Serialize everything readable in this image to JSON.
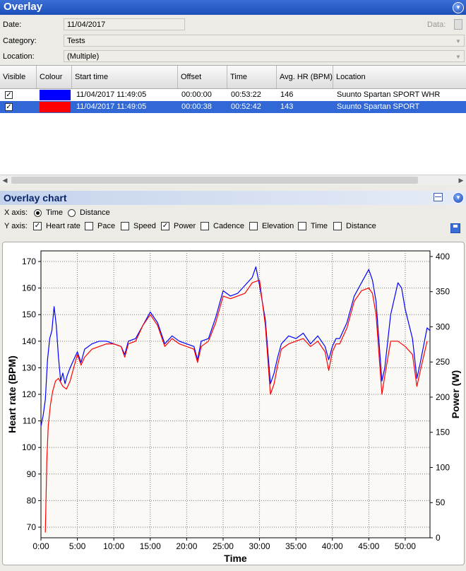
{
  "header": {
    "title": "Overlay"
  },
  "fields": {
    "date_label": "Date:",
    "date_value": "11/04/2017",
    "data_label": "Data:",
    "category_label": "Category:",
    "category_value": "Tests",
    "location_label": "Location:",
    "location_value": "(Multiple)"
  },
  "grid": {
    "columns": [
      "Visible",
      "Colour",
      "Start time",
      "Offset",
      "Time",
      "Avg. HR (BPM)",
      "Location"
    ],
    "rows": [
      {
        "visible": true,
        "colour": "#0000ff",
        "start": "11/04/2017 11:49:05",
        "offset": "00:00:00",
        "time": "00:53:22",
        "avghr": "146",
        "location": "Suunto Spartan SPORT WHR"
      },
      {
        "visible": true,
        "colour": "#ff0000",
        "start": "11/04/2017 11:49:05",
        "offset": "00:00:38",
        "time": "00:52:42",
        "avghr": "143",
        "location": "Suunto Spartan SPORT"
      }
    ]
  },
  "overlay_chart": {
    "title": "Overlay chart",
    "xaxis_label": "X axis:",
    "x_options": [
      {
        "label": "Time",
        "selected": true
      },
      {
        "label": "Distance",
        "selected": false
      }
    ],
    "yaxis_label": "Y axis:",
    "y_options": [
      {
        "label": "Heart rate",
        "checked": true
      },
      {
        "label": "Pace",
        "checked": false
      },
      {
        "label": "Speed",
        "checked": false
      },
      {
        "label": "Power",
        "checked": true
      },
      {
        "label": "Cadence",
        "checked": false
      },
      {
        "label": "Elevation",
        "checked": false
      },
      {
        "label": "Time",
        "checked": false
      },
      {
        "label": "Distance",
        "checked": false
      }
    ]
  },
  "chart_data": {
    "type": "line",
    "xlabel": "Time",
    "ylabel": "Heart rate (BPM)",
    "y2label": "Power (W)",
    "x_ticks": [
      "0:00",
      "5:00",
      "10:00",
      "15:00",
      "20:00",
      "25:00",
      "30:00",
      "35:00",
      "40:00",
      "45:00",
      "50:00"
    ],
    "xlim": [
      0,
      53.4
    ],
    "ylim": [
      66,
      174
    ],
    "y2lim": [
      0,
      408
    ],
    "y_ticks": [
      70,
      80,
      90,
      100,
      110,
      120,
      130,
      140,
      150,
      160,
      170
    ],
    "y2_ticks": [
      0,
      50,
      100,
      150,
      200,
      250,
      300,
      350,
      400
    ],
    "grid": true,
    "series": [
      {
        "color": "#0000ff",
        "points": [
          [
            0,
            108
          ],
          [
            0.3,
            112
          ],
          [
            0.6,
            118
          ],
          [
            0.9,
            133
          ],
          [
            1.2,
            141
          ],
          [
            1.5,
            144
          ],
          [
            1.8,
            153
          ],
          [
            2.1,
            146
          ],
          [
            2.4,
            134
          ],
          [
            2.7,
            125
          ],
          [
            3,
            128
          ],
          [
            3.3,
            124
          ],
          [
            3.6,
            127
          ],
          [
            4,
            130
          ],
          [
            4.5,
            133
          ],
          [
            5,
            136
          ],
          [
            5.5,
            132
          ],
          [
            6,
            137
          ],
          [
            7,
            139
          ],
          [
            8,
            140
          ],
          [
            9,
            140
          ],
          [
            10,
            139
          ],
          [
            11,
            138
          ],
          [
            11.5,
            135
          ],
          [
            12,
            140
          ],
          [
            13,
            141
          ],
          [
            14,
            146
          ],
          [
            15,
            151
          ],
          [
            16,
            147
          ],
          [
            17,
            139
          ],
          [
            18,
            142
          ],
          [
            19,
            140
          ],
          [
            20,
            139
          ],
          [
            21,
            138
          ],
          [
            21.5,
            133
          ],
          [
            22,
            140
          ],
          [
            23,
            141
          ],
          [
            24,
            149
          ],
          [
            25,
            159
          ],
          [
            26,
            157
          ],
          [
            27,
            158
          ],
          [
            28,
            161
          ],
          [
            29,
            164
          ],
          [
            29.5,
            168
          ],
          [
            30,
            161
          ],
          [
            30.8,
            148
          ],
          [
            31.5,
            124
          ],
          [
            32,
            128
          ],
          [
            32.5,
            134
          ],
          [
            33,
            139
          ],
          [
            34,
            142
          ],
          [
            35,
            141
          ],
          [
            36,
            143
          ],
          [
            37,
            139
          ],
          [
            38,
            142
          ],
          [
            39,
            138
          ],
          [
            39.5,
            133
          ],
          [
            40,
            138
          ],
          [
            40.5,
            141
          ],
          [
            41,
            141
          ],
          [
            42,
            147
          ],
          [
            43,
            157
          ],
          [
            44,
            162
          ],
          [
            45,
            167
          ],
          [
            45.5,
            163
          ],
          [
            46,
            155
          ],
          [
            46.8,
            125
          ],
          [
            47.2,
            130
          ],
          [
            48,
            150
          ],
          [
            49,
            162
          ],
          [
            49.5,
            160
          ],
          [
            50,
            152
          ],
          [
            51,
            141
          ],
          [
            51.6,
            126
          ],
          [
            52,
            131
          ],
          [
            53,
            145
          ],
          [
            53.4,
            144
          ]
        ]
      },
      {
        "color": "#ff0000",
        "points": [
          [
            0.6,
            68
          ],
          [
            0.8,
            95
          ],
          [
            1,
            108
          ],
          [
            1.3,
            116
          ],
          [
            1.6,
            121
          ],
          [
            2,
            125
          ],
          [
            2.4,
            126
          ],
          [
            3,
            123
          ],
          [
            3.5,
            122
          ],
          [
            4,
            125
          ],
          [
            4.5,
            130
          ],
          [
            5,
            135
          ],
          [
            5.5,
            131
          ],
          [
            6,
            134
          ],
          [
            7,
            137
          ],
          [
            8,
            138
          ],
          [
            9,
            139
          ],
          [
            10,
            139
          ],
          [
            11,
            138
          ],
          [
            11.5,
            134
          ],
          [
            12,
            139
          ],
          [
            13,
            140
          ],
          [
            14,
            146
          ],
          [
            15,
            150
          ],
          [
            16,
            146
          ],
          [
            17,
            138
          ],
          [
            18,
            141
          ],
          [
            19,
            139
          ],
          [
            20,
            138
          ],
          [
            21,
            137
          ],
          [
            21.5,
            132
          ],
          [
            22,
            138
          ],
          [
            23,
            140
          ],
          [
            24,
            147
          ],
          [
            25,
            157
          ],
          [
            26,
            156
          ],
          [
            27,
            157
          ],
          [
            28,
            158
          ],
          [
            29,
            162
          ],
          [
            30,
            163
          ],
          [
            30.8,
            146
          ],
          [
            31.5,
            120
          ],
          [
            32,
            124
          ],
          [
            32.5,
            131
          ],
          [
            33,
            137
          ],
          [
            34,
            139
          ],
          [
            35,
            140
          ],
          [
            36,
            141
          ],
          [
            37,
            138
          ],
          [
            38,
            140
          ],
          [
            39,
            136
          ],
          [
            39.5,
            129
          ],
          [
            40,
            136
          ],
          [
            40.5,
            139
          ],
          [
            41,
            139
          ],
          [
            42,
            145
          ],
          [
            43,
            155
          ],
          [
            44,
            159
          ],
          [
            45,
            160
          ],
          [
            45.5,
            158
          ],
          [
            46,
            150
          ],
          [
            46.8,
            120
          ],
          [
            47.2,
            127
          ],
          [
            48,
            140
          ],
          [
            49,
            140
          ],
          [
            50,
            138
          ],
          [
            51,
            135
          ],
          [
            51.6,
            123
          ],
          [
            52,
            128
          ],
          [
            53,
            140
          ]
        ]
      }
    ]
  },
  "colors": {
    "accent": "#3168d5",
    "title_bar": "#1d4fb8"
  }
}
